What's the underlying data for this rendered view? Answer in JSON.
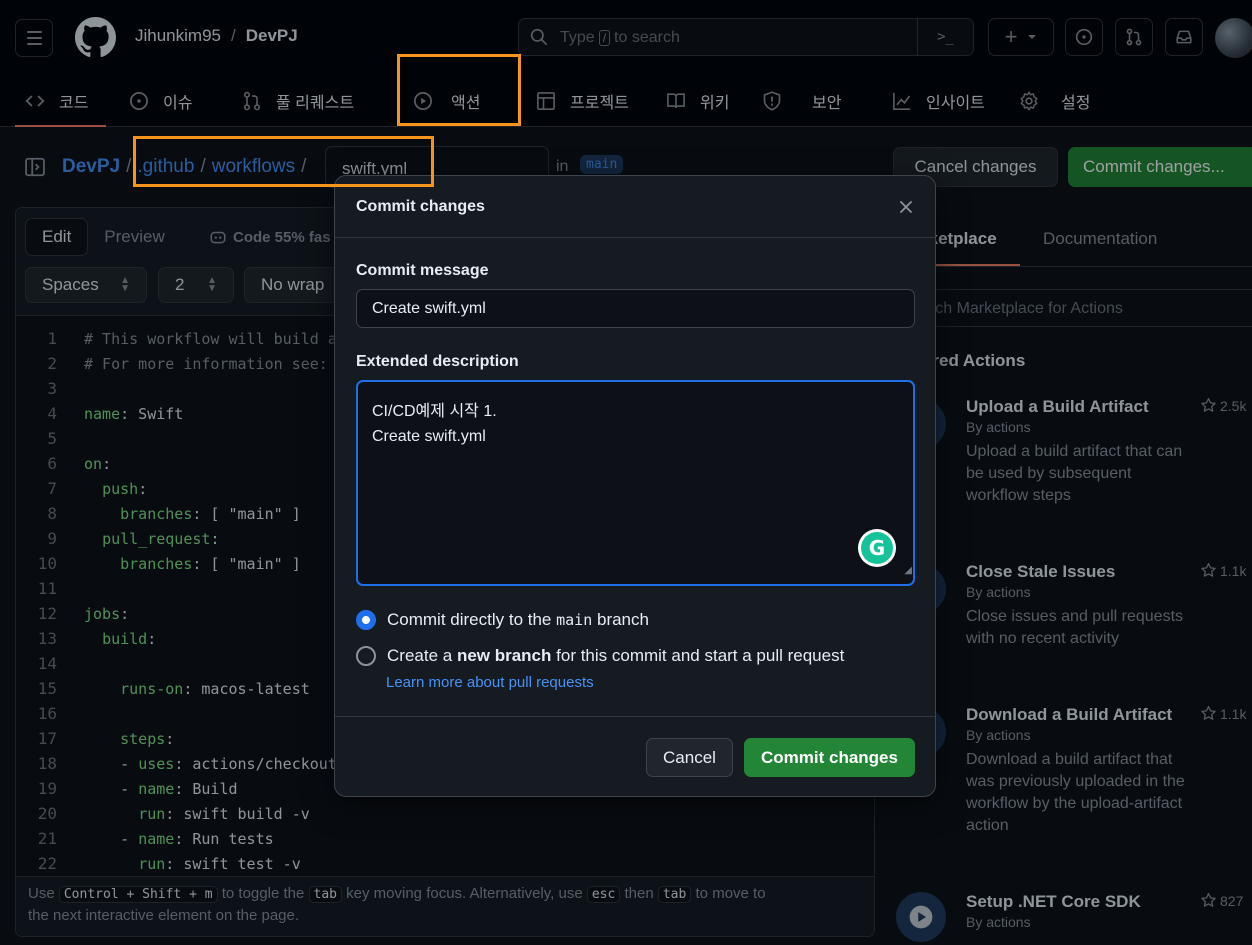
{
  "header": {
    "owner": "Jihunkim95",
    "separator": "/",
    "repo": "DevPJ",
    "search_placeholder_before": "Type",
    "search_key": "/",
    "search_placeholder_after": "to search",
    "command_symbol": ">_",
    "plus_symbol": "+",
    "nav_tabs": [
      {
        "label": "코드",
        "icon": "code-icon"
      },
      {
        "label": "이슈",
        "icon": "issue-icon"
      },
      {
        "label": "풀 리퀘스트",
        "icon": "pull-request-icon"
      },
      {
        "label": "액션",
        "icon": "play-icon"
      },
      {
        "label": "프로젝트",
        "icon": "table-icon"
      },
      {
        "label": "위키",
        "icon": "book-icon"
      },
      {
        "label": "보안",
        "icon": "shield-icon"
      },
      {
        "label": "인사이트",
        "icon": "graph-icon"
      },
      {
        "label": "설정",
        "icon": "gear-icon"
      }
    ]
  },
  "breadcrumb": {
    "repo": "DevPJ",
    "dir1": ".github",
    "dir2": "workflows",
    "sep": "/",
    "filename": "swift.yml",
    "in_label": "in",
    "branch": "main"
  },
  "top_actions": {
    "cancel": "Cancel changes",
    "commit": "Commit changes..."
  },
  "editor": {
    "tab_edit": "Edit",
    "tab_preview": "Preview",
    "copilot_note": "Code 55% fas",
    "indent_mode": "Spaces",
    "indent_size": "2",
    "wrap_mode": "No wrap",
    "lines": [
      {
        "n": "1",
        "code": "# This workflow will build a"
      },
      {
        "n": "2",
        "code": "# For more information see:"
      },
      {
        "n": "3",
        "code": ""
      },
      {
        "n": "4",
        "code": "name: Swift"
      },
      {
        "n": "5",
        "code": ""
      },
      {
        "n": "6",
        "code": "on:"
      },
      {
        "n": "7",
        "code": "  push:"
      },
      {
        "n": "8",
        "code": "    branches: [ \"main\" ]"
      },
      {
        "n": "9",
        "code": "  pull_request:"
      },
      {
        "n": "10",
        "code": "    branches: [ \"main\" ]"
      },
      {
        "n": "11",
        "code": ""
      },
      {
        "n": "12",
        "code": "jobs:"
      },
      {
        "n": "13",
        "code": "  build:"
      },
      {
        "n": "14",
        "code": ""
      },
      {
        "n": "15",
        "code": "    runs-on: macos-latest"
      },
      {
        "n": "16",
        "code": ""
      },
      {
        "n": "17",
        "code": "    steps:"
      },
      {
        "n": "18",
        "code": "    - uses: actions/checkout"
      },
      {
        "n": "19",
        "code": "    - name: Build"
      },
      {
        "n": "20",
        "code": "      run: swift build -v"
      },
      {
        "n": "21",
        "code": "    - name: Run tests"
      },
      {
        "n": "22",
        "code": "      run: swift test -v"
      }
    ],
    "footer_use": "Use",
    "footer_shortcut": "Control + Shift + m",
    "footer_toggle": "to toggle the",
    "footer_tab": "tab",
    "footer_rest": "key moving focus. Alternatively, use",
    "footer_esc": "esc",
    "footer_then": "then",
    "footer_tab2": "tab",
    "footer_end": "to move to",
    "footer_line2": "the next interactive element on the page."
  },
  "right_panel": {
    "tab_marketplace": "rketplace",
    "tab_docs": "Documentation",
    "search_placeholder": "arch Marketplace for Actions",
    "featured_title": "ured Actions",
    "actions": [
      {
        "name": "Upload a Build Artifact",
        "by": "By actions",
        "desc": "Upload a build artifact that can be used by subsequent workflow steps",
        "stars": "2.5k"
      },
      {
        "name": "Close Stale Issues",
        "by": "By actions",
        "desc": "Close issues and pull requests with no recent activity",
        "stars": "1.1k"
      },
      {
        "name": "Download a Build Artifact",
        "by": "By actions",
        "desc": "Download a build artifact that was previously uploaded in the workflow by the upload-artifact action",
        "stars": "1.1k"
      },
      {
        "name": "Setup .NET Core SDK",
        "by": "By actions",
        "desc": "",
        "stars": "827"
      }
    ]
  },
  "dialog": {
    "title": "Commit changes",
    "commit_message_label": "Commit message",
    "commit_message_value": "Create swift.yml",
    "extended_label": "Extended description",
    "extended_line1": "CI/CD예제 시작 1.",
    "extended_line2": "Create swift.yml",
    "grammarly_letter": "G",
    "option1_pre": "Commit directly to the",
    "option1_branch": "main",
    "option1_post": "branch",
    "option2_pre": "Create a",
    "option2_bold": "new branch",
    "option2_post": "for this commit and start a pull request",
    "learn_more": "Learn more about pull requests",
    "cancel": "Cancel",
    "commit": "Commit changes"
  },
  "colors": {
    "accent_blue": "#4493f8",
    "commit_green": "#238636",
    "annotation_orange": "#f7941d"
  }
}
